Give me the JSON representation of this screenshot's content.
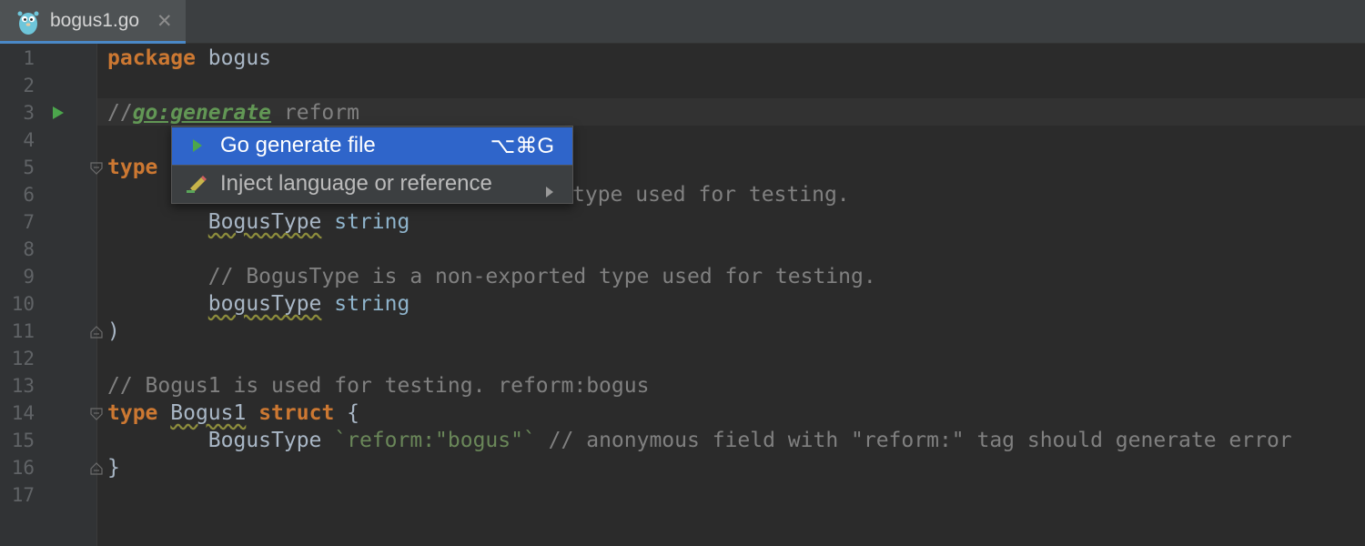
{
  "tab": {
    "title": "bogus1.go",
    "close_glyph": "✕",
    "icon": "gopher-icon"
  },
  "editor": {
    "line_numbers": [
      "1",
      "2",
      "3",
      "4",
      "5",
      "6",
      "7",
      "8",
      "9",
      "10",
      "11",
      "12",
      "13",
      "14",
      "15",
      "16",
      "17"
    ],
    "line1": {
      "kw": "package",
      "name": " bogus"
    },
    "line3": {
      "slashes": "//",
      "directive": "go:generate",
      "rest": " reform"
    },
    "line5": {
      "kw": "type"
    },
    "line6": {
      "comment": "type used for testing."
    },
    "line7": {
      "indent": "        ",
      "field": "BogusType",
      "type": " string"
    },
    "line9": {
      "indent": "        ",
      "comment": "// BogusType is a non-exported type used for testing."
    },
    "line10": {
      "indent": "        ",
      "field": "bogusType",
      "type": " string"
    },
    "line11": {
      "text": ")"
    },
    "line13": {
      "comment": "// Bogus1 is used for testing. reform:bogus"
    },
    "line14": {
      "kw1": "type",
      "name": "Bogus1",
      "kw2": "struct",
      "brace": " {"
    },
    "line15": {
      "indent": "        ",
      "field": "BogusType",
      "tag": "`reform:\"bogus\"`",
      "comment": " // anonymous field with \"reform:\" tag should generate error"
    },
    "line16": {
      "text": "}"
    }
  },
  "popup": {
    "items": [
      {
        "label": "Go generate file",
        "shortcut": "⌥⌘G",
        "icon": "run-icon"
      },
      {
        "label": "Inject language or reference",
        "icon": "pencil-icon",
        "submenu_glyph": "▶"
      }
    ]
  },
  "colors": {
    "keyword": "#cc7832",
    "comment": "#808080",
    "string": "#6a8759",
    "selection": "#2f65ca",
    "run_marker": "#4ca64c"
  }
}
